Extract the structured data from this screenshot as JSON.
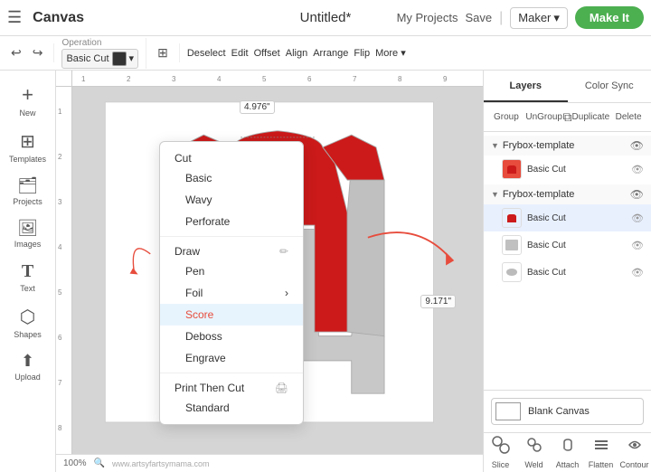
{
  "topbar": {
    "hamburger_icon": "☰",
    "canvas_label": "Canvas",
    "doc_title": "Untitled*",
    "my_projects_label": "My Projects",
    "save_label": "Save",
    "divider": "|",
    "maker_label": "Maker",
    "maker_chevron": "▾",
    "make_it_label": "Make It"
  },
  "toolbar": {
    "undo_icon": "↩",
    "redo_icon": "↪",
    "operation_label": "Operation",
    "operation_value": "Basic Cut",
    "deselect_label": "Deselect",
    "edit_label": "Edit",
    "offset_label": "Offset",
    "align_label": "Align",
    "arrange_label": "Arrange",
    "flip_label": "Flip",
    "more_label": "More ▾"
  },
  "operation_menu": {
    "cut_header": "Cut",
    "items": [
      {
        "label": "Basic",
        "indent": true,
        "active": false
      },
      {
        "label": "Wavy",
        "indent": true,
        "active": false
      },
      {
        "label": "Perforate",
        "indent": true,
        "active": false
      },
      {
        "label": "Draw",
        "indent": false,
        "is_header": true,
        "has_icon": true
      },
      {
        "label": "Pen",
        "indent": true,
        "active": false
      },
      {
        "label": "Foil",
        "indent": true,
        "active": false,
        "has_arrow": true
      },
      {
        "label": "Score",
        "indent": true,
        "active": true,
        "highlighted": true
      },
      {
        "label": "Deboss",
        "indent": true,
        "active": false
      },
      {
        "label": "Engrave",
        "indent": true,
        "active": false
      },
      {
        "label": "Print Then Cut",
        "indent": false,
        "is_header": true,
        "has_icon": true
      },
      {
        "label": "Standard",
        "indent": true,
        "active": false
      }
    ]
  },
  "sidebar": {
    "items": [
      {
        "label": "New",
        "icon": "+"
      },
      {
        "label": "Templates",
        "icon": "⊞"
      },
      {
        "label": "Projects",
        "icon": "📁"
      },
      {
        "label": "Images",
        "icon": "🖼"
      },
      {
        "label": "Text",
        "icon": "T"
      },
      {
        "label": "Shapes",
        "icon": "⬡"
      },
      {
        "label": "Upload",
        "icon": "⬆"
      }
    ]
  },
  "canvas": {
    "zoom_label": "100%",
    "width_label": "4.976\"",
    "height_label": "9.171\""
  },
  "layers_panel": {
    "layers_tab": "Layers",
    "color_sync_tab": "Color Sync",
    "group_action": "Group",
    "ungroup_action": "UnGroup",
    "duplicate_action": "Duplicate",
    "delete_action": "Delete",
    "groups": [
      {
        "name": "Frybox-template",
        "items": [
          {
            "label": "Basic Cut",
            "color": "#e74c3c"
          }
        ]
      },
      {
        "name": "Frybox-template",
        "items": [
          {
            "label": "Basic Cut",
            "color": "#e74c3c",
            "selected": true
          },
          {
            "label": "Basic Cut",
            "color": "#aaa"
          },
          {
            "label": "Basic Cut",
            "color": "#bbb",
            "is_gray_shape": true
          }
        ]
      }
    ],
    "blank_canvas_label": "Blank Canvas"
  },
  "panel_toolbar": {
    "slice_label": "Slice",
    "weld_label": "Weld",
    "attach_label": "Attach",
    "flatten_label": "Flatten",
    "contour_label": "Contour"
  }
}
